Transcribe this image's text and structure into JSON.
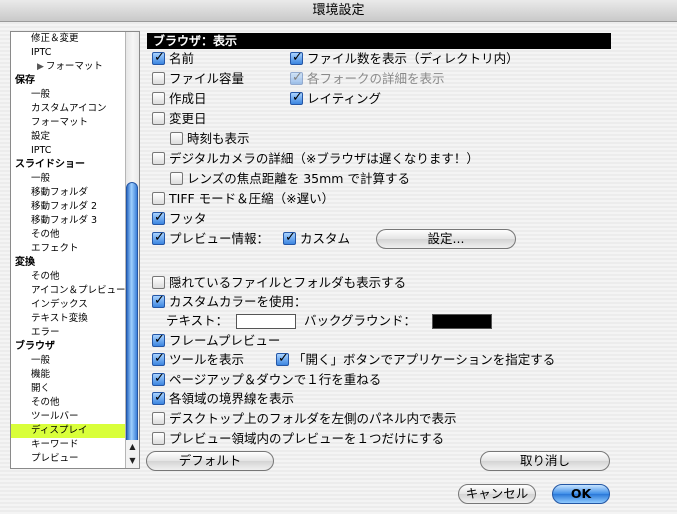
{
  "window": {
    "title": "環境設定"
  },
  "sidebar": {
    "items": [
      {
        "label": "修正＆変更",
        "kind": "item"
      },
      {
        "label": "IPTC",
        "kind": "item"
      },
      {
        "label": "フォーマット",
        "kind": "sub2"
      },
      {
        "label": "保存",
        "kind": "head"
      },
      {
        "label": "一般",
        "kind": "item"
      },
      {
        "label": "カスタムアイコン",
        "kind": "item"
      },
      {
        "label": "フォーマット",
        "kind": "item"
      },
      {
        "label": "設定",
        "kind": "item"
      },
      {
        "label": "IPTC",
        "kind": "item"
      },
      {
        "label": "スライドショー",
        "kind": "head"
      },
      {
        "label": "一般",
        "kind": "item"
      },
      {
        "label": "移動フォルダ",
        "kind": "item"
      },
      {
        "label": "移動フォルダ 2",
        "kind": "item"
      },
      {
        "label": "移動フォルダ 3",
        "kind": "item"
      },
      {
        "label": "その他",
        "kind": "item"
      },
      {
        "label": "エフェクト",
        "kind": "item"
      },
      {
        "label": "変換",
        "kind": "head"
      },
      {
        "label": "その他",
        "kind": "item"
      },
      {
        "label": "アイコン＆プレビュー",
        "kind": "item"
      },
      {
        "label": "インデックス",
        "kind": "item"
      },
      {
        "label": "テキスト変換",
        "kind": "item"
      },
      {
        "label": "エラー",
        "kind": "item"
      },
      {
        "label": "ブラウザ",
        "kind": "head"
      },
      {
        "label": "一般",
        "kind": "item"
      },
      {
        "label": "機能",
        "kind": "item"
      },
      {
        "label": "開く",
        "kind": "item"
      },
      {
        "label": "その他",
        "kind": "item"
      },
      {
        "label": "ツールバー",
        "kind": "item"
      },
      {
        "label": "ディスプレイ",
        "kind": "selected"
      },
      {
        "label": "キーワード",
        "kind": "item"
      },
      {
        "label": "プレビュー",
        "kind": "item"
      }
    ]
  },
  "panel": {
    "header": "ブラウザ：表示",
    "options": {
      "name": {
        "label": "名前",
        "checked": true
      },
      "file_count": {
        "label": "ファイル数を表示（ディレクトリ内）",
        "checked": true
      },
      "file_size": {
        "label": "ファイル容量",
        "checked": false
      },
      "fork_details": {
        "label": "各フォークの詳細を表示",
        "checked": true,
        "disabled": true
      },
      "created": {
        "label": "作成日",
        "checked": false
      },
      "rating": {
        "label": "レイティング",
        "checked": true
      },
      "modified": {
        "label": "変更日",
        "checked": false
      },
      "show_time": {
        "label": "時刻も表示",
        "checked": false
      },
      "camera_details": {
        "label": "デジタルカメラの詳細（※ブラウザは遅くなります！）",
        "checked": false
      },
      "focal_35mm": {
        "label": "レンズの焦点距離を 35mm で計算する",
        "checked": false
      },
      "tiff_mode": {
        "label": "TIFF モード＆圧縮（※遅い）",
        "checked": false
      },
      "footer": {
        "label": "フッタ",
        "checked": true
      },
      "preview_info": {
        "label": "プレビュー情報：",
        "checked": true
      },
      "custom": {
        "label": "カスタム",
        "checked": true
      },
      "show_hidden": {
        "label": "隠れているファイルとフォルダも表示する",
        "checked": false
      },
      "custom_color": {
        "label": "カスタムカラーを使用：",
        "checked": true
      },
      "frame_preview": {
        "label": "フレームプレビュー",
        "checked": true
      },
      "show_tools": {
        "label": "ツールを表示",
        "checked": true
      },
      "open_button_app": {
        "label": "「開く」ボタンでアプリケーションを指定する",
        "checked": true
      },
      "page_overlap": {
        "label": "ページアップ＆ダウンで１行を重ねる",
        "checked": true
      },
      "show_borders": {
        "label": "各領域の境界線を表示",
        "checked": true
      },
      "desktop_left": {
        "label": "デスクトップ上のフォルダを左側のパネル内で表示",
        "checked": false
      },
      "single_preview": {
        "label": "プレビュー領域内のプレビューを１つだけにする",
        "checked": false
      }
    },
    "settings_button": "設定...",
    "text_label": "テキスト：",
    "background_label": "バックグラウンド：",
    "text_color": "#ffffff",
    "background_color": "#000000"
  },
  "buttons": {
    "default": "デフォルト",
    "revert": "取り消し",
    "cancel": "キャンセル",
    "ok": "OK"
  }
}
